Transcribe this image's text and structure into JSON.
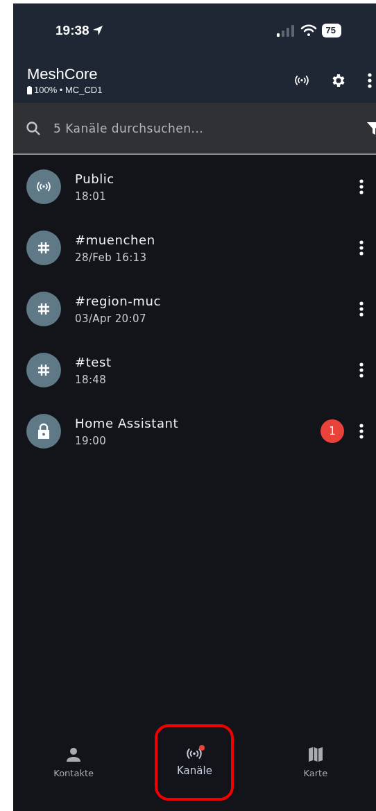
{
  "status_bar": {
    "time": "19:38",
    "battery": "75"
  },
  "app_bar": {
    "title": "MeshCore",
    "subtitle": "100% • MC_CD1"
  },
  "search": {
    "placeholder": "5 Kanäle durchsuchen..."
  },
  "channels": [
    {
      "kind": "broadcast",
      "name": "Public",
      "time": "18:01"
    },
    {
      "kind": "hashtag",
      "name": "#muenchen",
      "time": "28/Feb 16:13"
    },
    {
      "kind": "hashtag",
      "name": "#region-muc",
      "time": "03/Apr 20:07"
    },
    {
      "kind": "hashtag",
      "name": "#test",
      "time": "18:48"
    },
    {
      "kind": "private",
      "name": "Home Assistant",
      "time": "19:00",
      "unread": "1"
    }
  ],
  "bottom_nav": [
    {
      "kind": "contacts",
      "label": "Kontakte",
      "selected": false,
      "dot": false
    },
    {
      "kind": "channels",
      "label": "Kanäle",
      "selected": true,
      "dot": true
    },
    {
      "kind": "map",
      "label": "Karte",
      "selected": false,
      "dot": false
    }
  ]
}
